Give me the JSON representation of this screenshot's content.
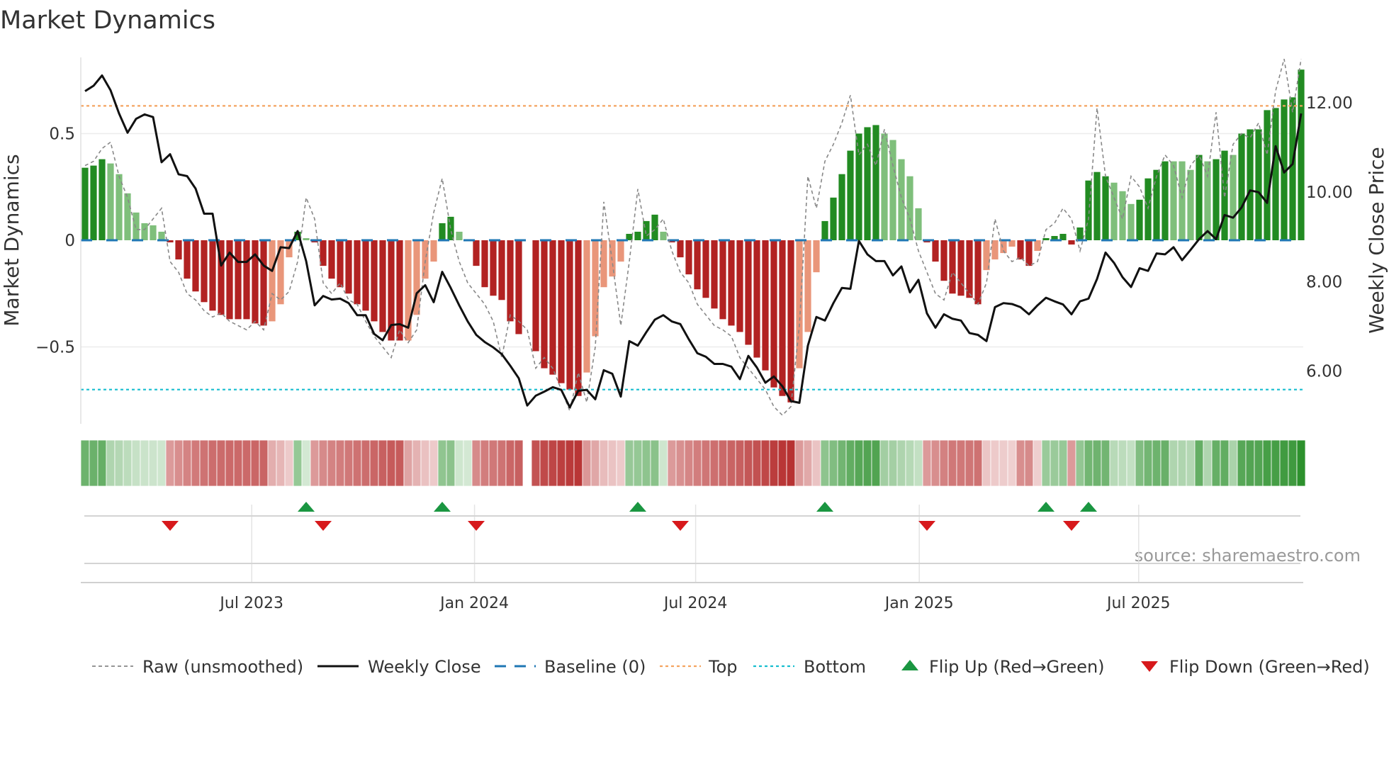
{
  "chart_data": {
    "type": "bar",
    "title": "Market Dynamics",
    "ylabel": "Market Dynamics",
    "y2label": "Weekly Close Price",
    "ylim": [
      -0.86,
      0.87
    ],
    "y2lim": [
      4.75,
      13.0
    ],
    "yticks": [
      {
        "v": 0.5,
        "label": "0.5"
      },
      {
        "v": 0,
        "label": "0"
      },
      {
        "v": -0.5,
        "label": "−0.5"
      }
    ],
    "y2ticks": [
      {
        "v": 12,
        "label": "12.00"
      },
      {
        "v": 10,
        "label": "10.00"
      },
      {
        "v": 8,
        "label": "8.00"
      },
      {
        "v": 6,
        "label": "6.00"
      }
    ],
    "xticks": [
      {
        "week": 19.6,
        "label": "Jul 2023"
      },
      {
        "week": 45.8,
        "label": "Jan 2024"
      },
      {
        "week": 71.8,
        "label": "Jul 2024"
      },
      {
        "week": 98.1,
        "label": "Jan 2025"
      },
      {
        "week": 123.9,
        "label": "Jul 2025"
      }
    ],
    "top_level": 0.63,
    "bottom_level": -0.7,
    "baseline": 0,
    "state_key": {
      "G": "strong green",
      "g": "fading green",
      "R": "strong red",
      "r": "fading red"
    },
    "colors": {
      "G": "#228b22",
      "g": "#7fbf7b",
      "R": "#b22222",
      "r": "#e9967a",
      "raw": "#888888",
      "close": "#111111",
      "baseline": "#1f77b4",
      "top": "#f4a460",
      "bottom": "#17becf",
      "flip_up": "#1a9641",
      "flip_down": "#d7191c"
    },
    "bars": [
      0.34,
      0.35,
      0.38,
      0.36,
      0.31,
      0.22,
      0.13,
      0.08,
      0.07,
      0.04,
      -0.01,
      -0.09,
      -0.18,
      -0.24,
      -0.29,
      -0.33,
      -0.35,
      -0.37,
      -0.37,
      -0.37,
      -0.39,
      -0.4,
      -0.38,
      -0.3,
      -0.08,
      0.04,
      0.01,
      -0.01,
      -0.12,
      -0.18,
      -0.22,
      -0.25,
      -0.3,
      -0.33,
      -0.38,
      -0.43,
      -0.47,
      -0.47,
      -0.47,
      -0.35,
      -0.18,
      -0.1,
      0.08,
      0.11,
      0.04,
      0.005,
      -0.12,
      -0.22,
      -0.26,
      -0.28,
      -0.38,
      -0.44,
      0,
      -0.52,
      -0.6,
      -0.63,
      -0.67,
      -0.7,
      -0.73,
      -0.62,
      -0.45,
      -0.22,
      -0.17,
      -0.1,
      0.03,
      0.04,
      0.09,
      0.12,
      0.04,
      -0.01,
      -0.08,
      -0.16,
      -0.23,
      -0.27,
      -0.32,
      -0.37,
      -0.4,
      -0.43,
      -0.49,
      -0.55,
      -0.61,
      -0.69,
      -0.73,
      -0.76,
      -0.6,
      -0.43,
      -0.15,
      0.09,
      0.2,
      0.31,
      0.42,
      0.5,
      0.53,
      0.54,
      0.5,
      0.47,
      0.38,
      0.3,
      0.15,
      -0.01,
      -0.1,
      -0.19,
      -0.25,
      -0.26,
      -0.27,
      -0.3,
      -0.14,
      -0.09,
      -0.06,
      -0.03,
      -0.09,
      -0.12,
      -0.05,
      0.01,
      0.02,
      0.03,
      -0.02,
      0.06,
      0.28,
      0.32,
      0.3,
      0.27,
      0.23,
      0.17,
      0.19,
      0.29,
      0.33,
      0.37,
      0.37,
      0.37,
      0.33,
      0.4,
      0.37,
      0.38,
      0.42,
      0.4,
      0.5,
      0.52,
      0.52,
      0.61,
      0.62,
      0.66,
      0.67,
      0.8
    ],
    "states": "GGGggggggg",
    "states_full": "GGGgggggggRRRRRRRRRRRRrrrGgRRRRRRRRRRRrrrrGGggRRRRRRxRRRRRRrrrrrGGGGgRRRRRRRRRRRRRRRrrrGGGGGGGgggggRRRRRRRrrrrRRrGGGRGGGGgggGGGGgggGgGGgGGGGGGGG",
    "raw": [
      0.35,
      0.37,
      0.43,
      0.46,
      0.3,
      0.2,
      0.05,
      0.05,
      0.1,
      0.15,
      -0.1,
      -0.15,
      -0.25,
      -0.28,
      -0.33,
      -0.36,
      -0.34,
      -0.38,
      -0.4,
      -0.42,
      -0.38,
      -0.42,
      -0.25,
      -0.28,
      -0.24,
      -0.1,
      0.2,
      0.1,
      -0.2,
      -0.25,
      -0.2,
      -0.28,
      -0.3,
      -0.38,
      -0.45,
      -0.5,
      -0.55,
      -0.42,
      -0.48,
      -0.42,
      -0.1,
      0.13,
      0.29,
      0.05,
      -0.1,
      -0.2,
      -0.25,
      -0.3,
      -0.38,
      -0.55,
      -0.35,
      -0.38,
      -0.42,
      -0.6,
      -0.55,
      -0.6,
      -0.7,
      -0.8,
      -0.62,
      -0.76,
      -0.5,
      0.18,
      -0.1,
      -0.4,
      -0.1,
      0.24,
      0.02,
      0.05,
      0.1,
      -0.05,
      -0.15,
      -0.2,
      -0.3,
      -0.35,
      -0.4,
      -0.42,
      -0.45,
      -0.55,
      -0.6,
      -0.65,
      -0.7,
      -0.78,
      -0.82,
      -0.78,
      -0.4,
      0.3,
      0.15,
      0.37,
      0.45,
      0.55,
      0.68,
      0.4,
      0.45,
      0.35,
      0.52,
      0.35,
      0.2,
      0.1,
      -0.05,
      -0.15,
      -0.25,
      -0.28,
      -0.15,
      -0.2,
      -0.25,
      -0.3,
      -0.2,
      0.1,
      -0.05,
      -0.1,
      -0.08,
      -0.12,
      -0.1,
      0.05,
      0.08,
      0.15,
      0.1,
      -0.05,
      0.1,
      0.62,
      0.3,
      0.2,
      0.1,
      0.3,
      0.25,
      0.15,
      0.3,
      0.4,
      0.35,
      0.2,
      0.35,
      0.4,
      0.3,
      0.6,
      0.2,
      0.45,
      0.5,
      0.48,
      0.55,
      0.4,
      0.7,
      0.85,
      0.6,
      0.85
    ],
    "close": [
      12.26,
      12.38,
      12.61,
      12.28,
      11.76,
      11.33,
      11.64,
      11.74,
      11.68,
      10.67,
      10.85,
      10.4,
      10.36,
      10.08,
      9.52,
      9.52,
      8.36,
      8.65,
      8.44,
      8.44,
      8.61,
      8.36,
      8.24,
      8.77,
      8.75,
      9.13,
      8.46,
      7.47,
      7.68,
      7.6,
      7.62,
      7.52,
      7.25,
      7.25,
      6.83,
      6.69,
      7.03,
      7.05,
      6.97,
      7.74,
      7.92,
      7.54,
      8.22,
      7.86,
      7.47,
      7.11,
      6.81,
      6.65,
      6.53,
      6.38,
      6.12,
      5.84,
      5.23,
      5.45,
      5.54,
      5.64,
      5.58,
      5.19,
      5.56,
      5.58,
      5.37,
      6.02,
      5.94,
      5.43,
      6.67,
      6.57,
      6.87,
      7.15,
      7.25,
      7.11,
      7.05,
      6.71,
      6.4,
      6.32,
      6.16,
      6.16,
      6.1,
      5.82,
      6.34,
      6.08,
      5.74,
      5.88,
      5.66,
      5.33,
      5.29,
      6.57,
      7.21,
      7.13,
      7.52,
      7.86,
      7.84,
      8.91,
      8.61,
      8.46,
      8.46,
      8.14,
      8.34,
      7.76,
      8.04,
      7.29,
      6.97,
      7.27,
      7.17,
      7.13,
      6.85,
      6.81,
      6.67,
      7.43,
      7.52,
      7.5,
      7.43,
      7.27,
      7.47,
      7.64,
      7.56,
      7.49,
      7.27,
      7.56,
      7.62,
      8.06,
      8.65,
      8.42,
      8.1,
      7.88,
      8.3,
      8.24,
      8.63,
      8.61,
      8.77,
      8.48,
      8.71,
      8.95,
      9.13,
      8.95,
      9.49,
      9.43,
      9.66,
      10.04,
      10.0,
      9.76,
      11.03,
      10.44,
      10.63,
      11.76
    ],
    "flip_up_weeks": [
      26,
      42,
      65,
      87,
      113,
      118
    ],
    "flip_down_weeks": [
      10,
      28,
      46,
      70,
      99,
      116
    ],
    "legend": [
      {
        "label": "Raw (unsmoothed)",
        "kind": "raw"
      },
      {
        "label": "Weekly Close",
        "kind": "close"
      },
      {
        "label": "Baseline (0)",
        "kind": "baseline"
      },
      {
        "label": "Top",
        "kind": "top"
      },
      {
        "label": "Bottom",
        "kind": "bottom"
      },
      {
        "label": "Flip Up (Red→Green)",
        "kind": "flip_up"
      },
      {
        "label": "Flip Down (Green→Red)",
        "kind": "flip_down"
      }
    ],
    "source": "source: sharemaestro.com"
  }
}
